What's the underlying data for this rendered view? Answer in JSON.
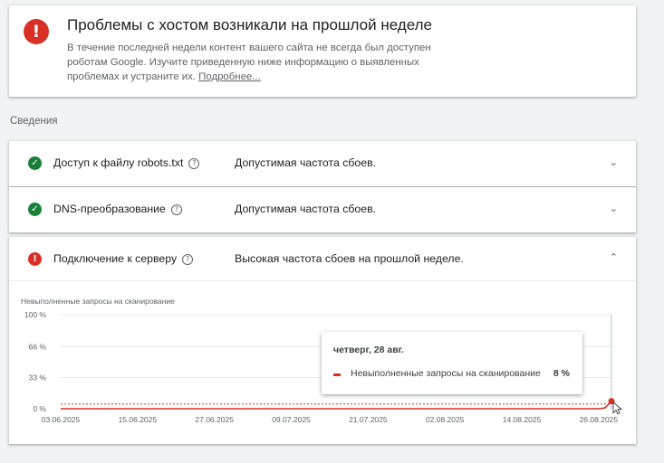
{
  "alert": {
    "title": "Проблемы с хостом возникали на прошлой неделе",
    "text": "В течение последней недели контент вашего сайта не всегда был доступен роботам Google. Изучите приведенную ниже информацию о выявленных проблемах и устраните их.",
    "more_link": "Подробнее...",
    "icon": "error-icon",
    "color": "#d93025"
  },
  "section_label": "Сведения",
  "rows": [
    {
      "name": "Доступ к файлу robots.txt",
      "status_icon": "check-icon",
      "status": "ok",
      "value": "Допустимая частота сбоев.",
      "chevron": "chevron-down-icon"
    },
    {
      "name": "DNS-преобразование",
      "status_icon": "check-icon",
      "status": "ok",
      "value": "Допустимая частота сбоев.",
      "chevron": "chevron-down-icon"
    },
    {
      "name": "Подключение к серверу",
      "status_icon": "error-icon",
      "status": "error",
      "value": "Высокая частота сбоев на прошлой неделе.",
      "chevron": "chevron-up-icon"
    }
  ],
  "chart_title": "Невыполненные запросы на сканирование",
  "tooltip": {
    "date": "четверг, 28 авг.",
    "series_name": "Невыполненные запросы на сканирование",
    "value": "8 %"
  },
  "colors": {
    "ok": "#188038",
    "error": "#d93025",
    "threshold": "#d93025"
  },
  "chart_data": {
    "type": "line",
    "title": "Невыполненные запросы на сканирование",
    "xlabel": "",
    "ylabel": "",
    "y_tick_labels": [
      "0 %",
      "33 %",
      "66 %",
      "100 %"
    ],
    "y_ticks": [
      0,
      33,
      66,
      100
    ],
    "ylim": [
      0,
      100
    ],
    "x_tick_labels": [
      "03.06.2025",
      "15.06.2025",
      "27.06.2025",
      "09.07.2025",
      "21.07.2025",
      "02.08.2025",
      "14.08.2025",
      "26.08.2025"
    ],
    "x_range": [
      "2025-06-03",
      "2025-08-28"
    ],
    "threshold": 5,
    "grid": true,
    "series": [
      {
        "name": "Невыполненные запросы на сканирование",
        "points": [
          [
            "2025-06-03",
            0
          ],
          [
            "2025-08-23",
            0
          ],
          [
            "2025-08-26",
            0
          ],
          [
            "2025-08-27",
            1
          ],
          [
            "2025-08-28",
            8
          ]
        ]
      }
    ],
    "highlight": {
      "x": "2025-08-28",
      "y": 8
    }
  }
}
